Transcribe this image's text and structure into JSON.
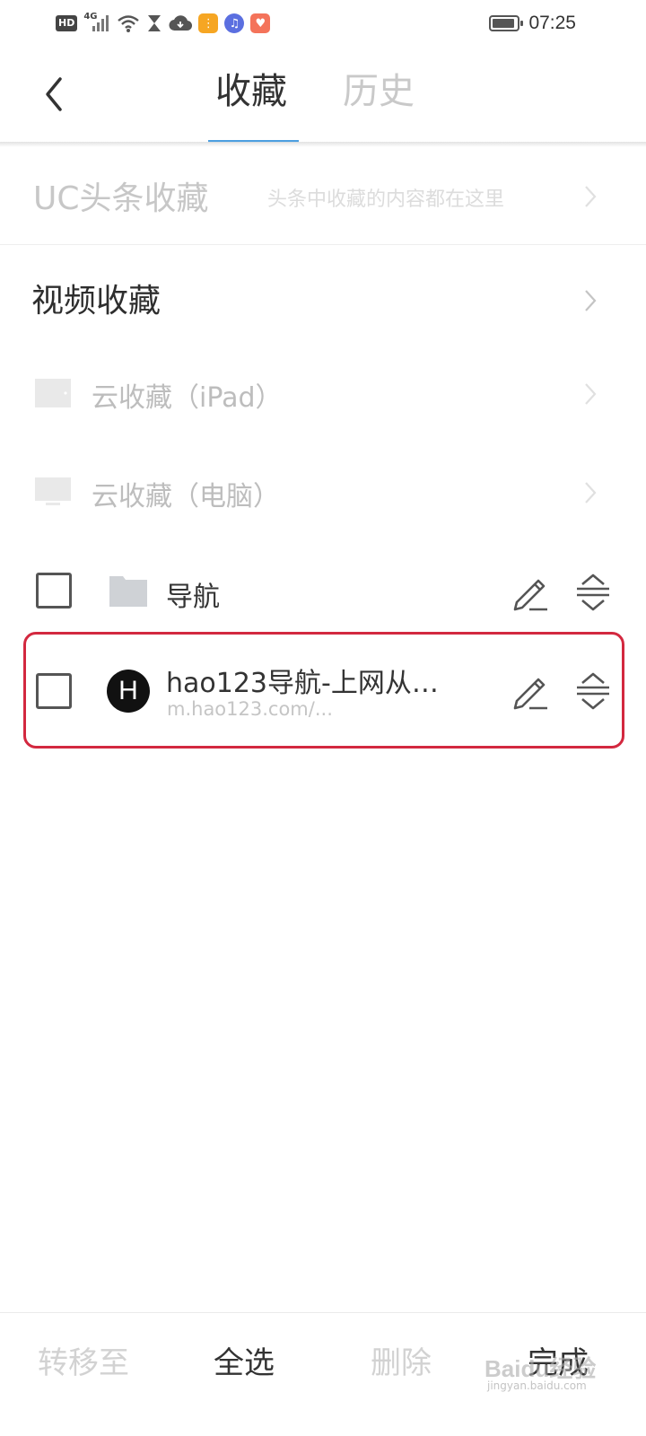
{
  "status_bar": {
    "hd": "HD",
    "network": "4G",
    "time": "07:25"
  },
  "header": {
    "tab_favorites": "收藏",
    "tab_history": "历史"
  },
  "uc_row": {
    "title": "UC头条收藏",
    "subtitle": "头条中收藏的内容都在这里"
  },
  "video_row": {
    "title": "视频收藏"
  },
  "cloud_rows": [
    {
      "label": "云收藏（iPad）",
      "icon": "tablet-icon"
    },
    {
      "label": "云收藏（电脑）",
      "icon": "monitor-icon"
    }
  ],
  "folder_item": {
    "label": "导航"
  },
  "site_item": {
    "icon_letter": "H",
    "title": "hao123导航-上网从…",
    "url": "m.hao123.com/..."
  },
  "bottom_bar": {
    "move": "转移至",
    "select_all": "全选",
    "delete": "删除",
    "done": "完成"
  },
  "watermark": {
    "text": "Baidu经验",
    "sub": "jingyan.baidu.com"
  },
  "colors": {
    "accent_underline": "#4d9fe0",
    "highlight_border": "#d3283f"
  }
}
